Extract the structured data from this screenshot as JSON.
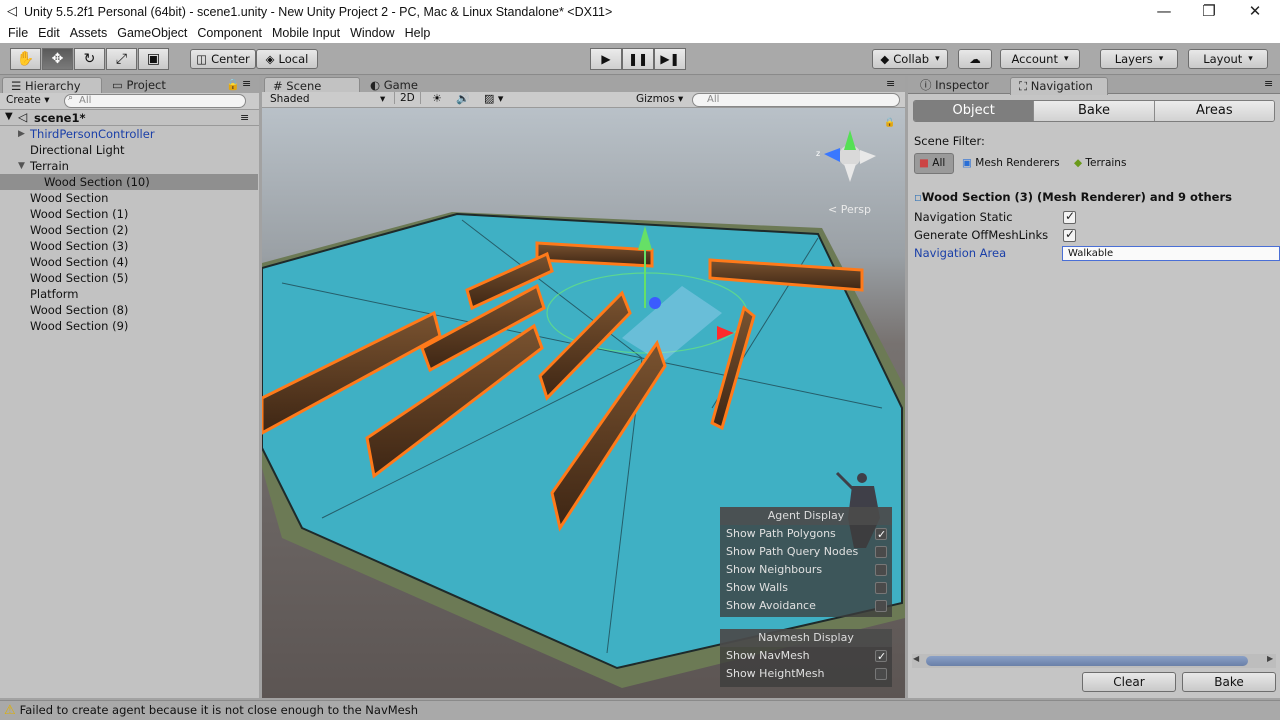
{
  "window": {
    "title": "Unity 5.5.2f1 Personal (64bit) - scene1.unity - New Unity Project 2 - PC, Mac & Linux Standalone* <DX11>",
    "controls": [
      "—",
      "❐",
      "✕"
    ]
  },
  "menu": [
    "File",
    "Edit",
    "Assets",
    "GameObject",
    "Component",
    "Mobile Input",
    "Window",
    "Help"
  ],
  "toolbar": {
    "pivot_center": "Center",
    "pivot_local": "Local",
    "collab": "Collab",
    "account": "Account",
    "layers": "Layers",
    "layout": "Layout"
  },
  "hierarchy": {
    "tab": "Hierarchy",
    "project_tab": "Project",
    "create": "Create",
    "search_placeholder": "All",
    "scene_name": "scene1*",
    "items": [
      {
        "label": "ThirdPersonController",
        "indent": 1,
        "arrow": "▶",
        "blue": true,
        "selected": false
      },
      {
        "label": "Directional Light",
        "indent": 1,
        "arrow": "",
        "blue": false,
        "selected": false
      },
      {
        "label": "Terrain",
        "indent": 1,
        "arrow": "▼",
        "blue": false,
        "selected": false
      },
      {
        "label": "Wood Section (10)",
        "indent": 2,
        "arrow": "",
        "blue": false,
        "selected": true
      },
      {
        "label": "Wood Section",
        "indent": 1,
        "arrow": "",
        "blue": false,
        "selected": false
      },
      {
        "label": "Wood Section (1)",
        "indent": 1,
        "arrow": "",
        "blue": false,
        "selected": false
      },
      {
        "label": "Wood Section (2)",
        "indent": 1,
        "arrow": "",
        "blue": false,
        "selected": false
      },
      {
        "label": "Wood Section (3)",
        "indent": 1,
        "arrow": "",
        "blue": false,
        "selected": false
      },
      {
        "label": "Wood Section (4)",
        "indent": 1,
        "arrow": "",
        "blue": false,
        "selected": false
      },
      {
        "label": "Wood Section (5)",
        "indent": 1,
        "arrow": "",
        "blue": false,
        "selected": false
      },
      {
        "label": "Platform",
        "indent": 1,
        "arrow": "",
        "blue": false,
        "selected": false
      },
      {
        "label": "Wood Section (8)",
        "indent": 1,
        "arrow": "",
        "blue": false,
        "selected": false
      },
      {
        "label": "Wood Section (9)",
        "indent": 1,
        "arrow": "",
        "blue": false,
        "selected": false
      }
    ]
  },
  "scene": {
    "tab": "Scene",
    "game_tab": "Game",
    "shading": "Shaded",
    "mode_2d": "2D",
    "gizmos": "Gizmos",
    "search_placeholder": "All",
    "persp_label": "Persp",
    "agent_display": {
      "title": "Agent Display",
      "rows": [
        {
          "label": "Show Path Polygons",
          "checked": true
        },
        {
          "label": "Show Path Query Nodes",
          "checked": false
        },
        {
          "label": "Show Neighbours",
          "checked": false
        },
        {
          "label": "Show Walls",
          "checked": false
        },
        {
          "label": "Show Avoidance",
          "checked": false
        }
      ]
    },
    "navmesh_display": {
      "title": "Navmesh Display",
      "rows": [
        {
          "label": "Show NavMesh",
          "checked": true
        },
        {
          "label": "Show HeightMesh",
          "checked": false
        }
      ]
    }
  },
  "inspector": {
    "tab": "Inspector",
    "nav_tab": "Navigation",
    "subtabs": [
      "Object",
      "Bake",
      "Areas"
    ],
    "scene_filter_label": "Scene Filter:",
    "filters": [
      "All",
      "Mesh Renderers",
      "Terrains"
    ],
    "object_title": "Wood Section (3) (Mesh Renderer) and 9 others",
    "nav_static_label": "Navigation Static",
    "nav_static": true,
    "offmesh_label": "Generate OffMeshLinks",
    "offmesh": true,
    "nav_area_label": "Navigation Area",
    "nav_area_value": "Walkable",
    "clear_button": "Clear",
    "bake_button": "Bake"
  },
  "status": {
    "message": "Failed to create agent because it is not close enough to the NavMesh"
  },
  "colors": {
    "water": "#3fb0c4",
    "wood": "#5a3a22",
    "selection_outline": "#ff7a1a",
    "link_blue": "#1a3fa8"
  }
}
